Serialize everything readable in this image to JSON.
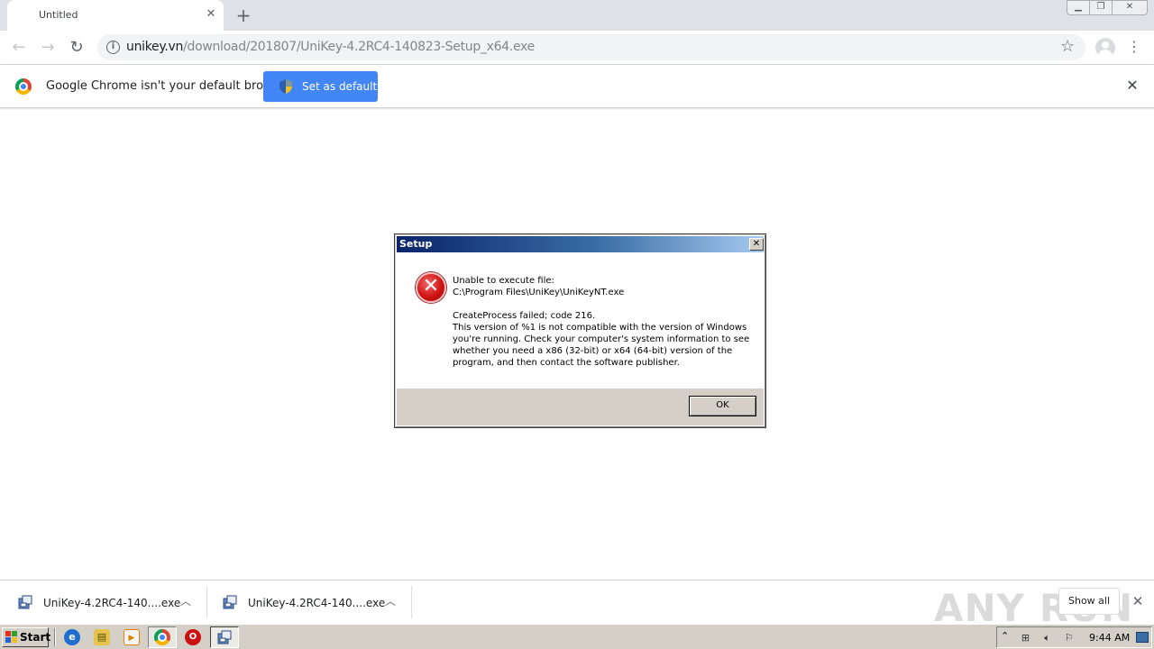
{
  "browser": {
    "tab_title": "Untitled",
    "url_domain": "unikey.vn",
    "url_path": "/download/201807/UniKey-4.2RC4-140823-Setup_x64.exe"
  },
  "infobar": {
    "message": "Google Chrome isn't your default browser",
    "button_label": "Set as default"
  },
  "dialog": {
    "title": "Setup",
    "lines": [
      "Unable to execute file:",
      "C:\\Program Files\\UniKey\\UniKeyNT.exe",
      "CreateProcess failed; code 216.",
      "This version of %1 is not compatible with the version of Windows",
      "you're running. Check your computer's system information to see",
      "whether you need a x86 (32-bit) or x64 (64-bit) version of the",
      "program, and then contact the software publisher."
    ],
    "ok_label": "OK"
  },
  "downloads": {
    "items": [
      {
        "name": "UniKey-4.2RC4-140....exe"
      },
      {
        "name": "UniKey-4.2RC4-140....exe"
      }
    ],
    "show_all_label": "Show all",
    "watermark": "ANY RUN"
  },
  "taskbar": {
    "start_label": "Start",
    "clock": "9:44 AM",
    "quick_launch": [
      "internet-explorer-icon",
      "explorer-icon",
      "media-player-icon",
      "chrome-icon",
      "opera-icon"
    ]
  },
  "colors": {
    "chrome_blue": "#4285f4",
    "title_bar_start": "#0a246a",
    "title_bar_end": "#a6caf0",
    "error_red": "#d01414",
    "taskbar": "#d4d0c8"
  }
}
